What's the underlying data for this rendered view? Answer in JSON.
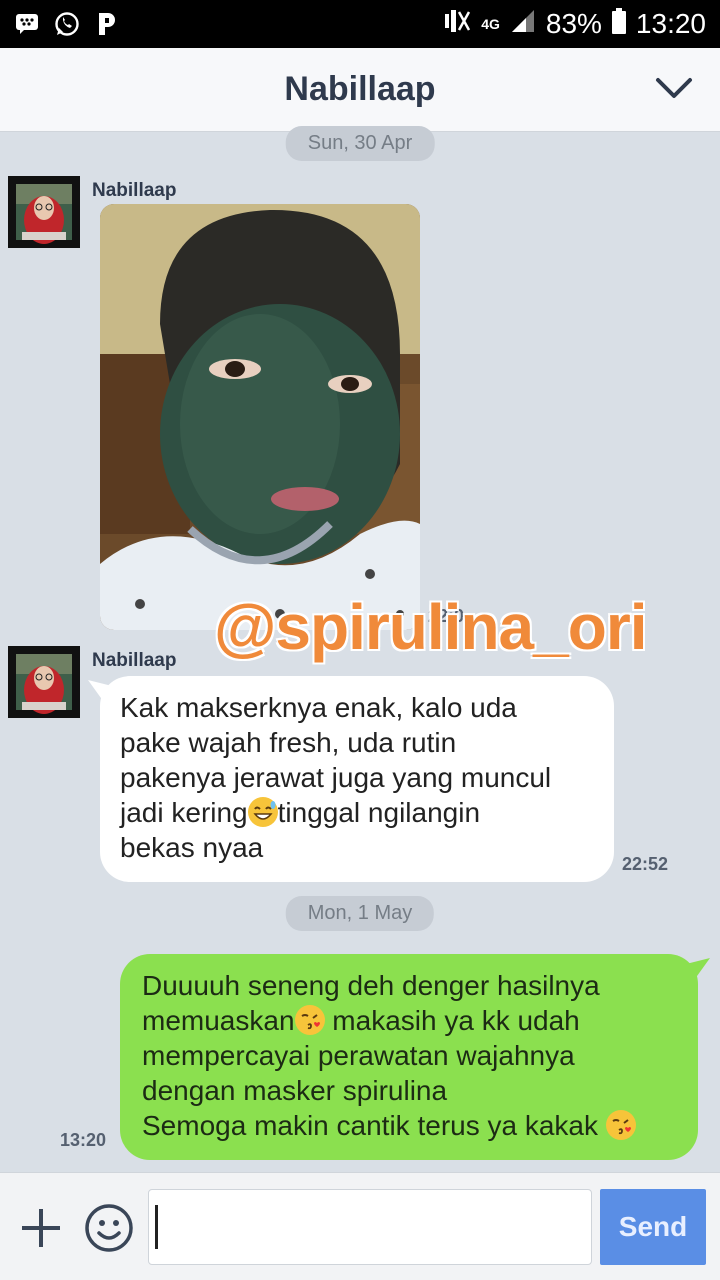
{
  "status_bar": {
    "signal_label": "4G",
    "battery": "83%",
    "time": "13:20",
    "icons": [
      "bbm-icon",
      "whatsapp-icon",
      "parking-icon",
      "mute-icon",
      "signal-icon",
      "battery-icon"
    ]
  },
  "header": {
    "title": "Nabillaap"
  },
  "messages": {
    "date_1": "Sun, 30 Apr",
    "sender_1": "Nabillaap",
    "photo_time": "22:0",
    "sender_2": "Nabillaap",
    "in_lines": [
      "Kak makserknya enak, kalo uda",
      "pake wajah fresh, uda rutin",
      "pakenya jerawat juga yang muncul",
      "jadi kering",
      "tinggal ngilangin",
      "bekas nyaa"
    ],
    "in_time": "22:52",
    "date_2": "Mon, 1 May",
    "out_lines": [
      "Duuuuh seneng deh denger hasilnya",
      "memuaskan",
      " makasih ya kk udah",
      "mempercayai perawatan wajahnya",
      "dengan masker spirulina",
      "Semoga makin cantik terus ya kakak "
    ],
    "out_time": "13:20"
  },
  "watermark": "@spirulina_ori",
  "input": {
    "placeholder": "",
    "send_label": "Send"
  },
  "colors": {
    "chat_bg": "#d9dfe6",
    "outgoing_bubble": "#8be04f",
    "send_button": "#5a8ee5",
    "watermark": "#f08a3a"
  }
}
